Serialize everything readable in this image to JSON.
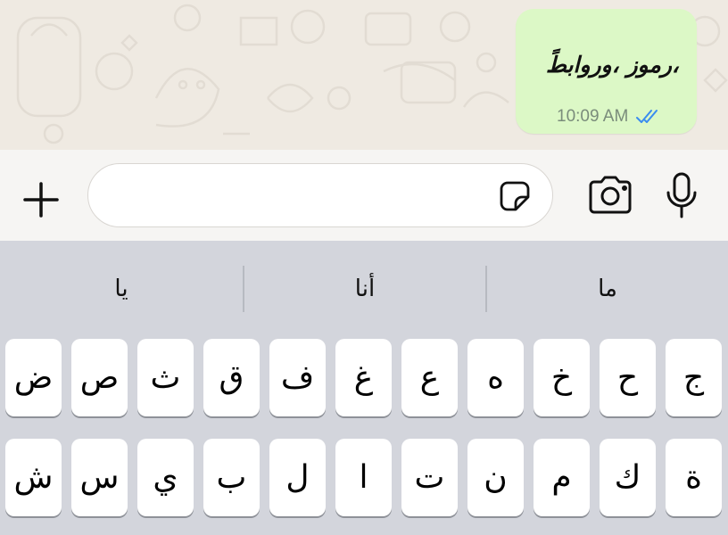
{
  "message": {
    "text": "،رموز ،وروابطً",
    "time": "10:09 AM",
    "status_icon": "double-check-icon",
    "status_color": "#3a8cf0",
    "bubble_color": "#dcf8c6"
  },
  "composer": {
    "text": "",
    "add_icon": "plus-icon",
    "sticker_icon": "sticker-icon",
    "camera_icon": "camera-icon",
    "mic_icon": "microphone-icon"
  },
  "keyboard": {
    "suggestions": [
      "يا",
      "أنا",
      "ما"
    ],
    "row1": [
      "ض",
      "ص",
      "ث",
      "ق",
      "ف",
      "غ",
      "ع",
      "ه",
      "خ",
      "ح",
      "ج"
    ],
    "row2": [
      "ش",
      "س",
      "ي",
      "ب",
      "ل",
      "ا",
      "ت",
      "ن",
      "م",
      "ك",
      "ة"
    ]
  }
}
